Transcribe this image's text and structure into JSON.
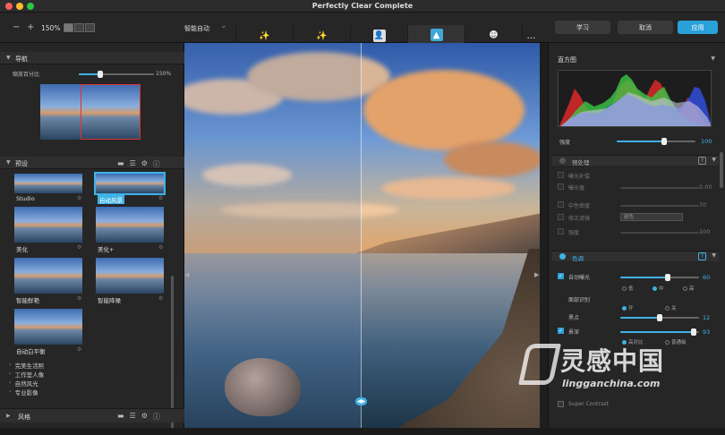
{
  "window": {
    "title": "Perfectly Clear Complete",
    "traffic_lights": {
      "close": "#fe5f57",
      "minimize": "#febc2e",
      "zoom": "#28c840"
    }
  },
  "toolbar": {
    "minus": "−",
    "plus": "+",
    "zoom_level": "150%",
    "auto_label": "智能自动",
    "presets": [
      {
        "label": "iAuto '21",
        "icon": "magic-wand"
      },
      {
        "label": "iAuto Asia",
        "icon": "magic-wand"
      },
      {
        "label": "Studio",
        "icon": "portrait"
      },
      {
        "label": "自动风景",
        "icon": "landscape",
        "active": true
      },
      {
        "label": "美化",
        "icon": "face"
      },
      {
        "label": "I",
        "icon": "more"
      }
    ]
  },
  "actions": {
    "learn": "学习",
    "cancel": "取消",
    "apply": "应用"
  },
  "navigator": {
    "title": "导航",
    "zoom_label": "缩放百分比",
    "zoom_value": "150%",
    "zoom_fraction": 0.28
  },
  "presets_panel": {
    "title": "预设",
    "items": [
      {
        "label": "Studio",
        "selected": false
      },
      {
        "label": "自动风景",
        "selected": true
      },
      {
        "label": "美化",
        "selected": false
      },
      {
        "label": "美化+",
        "selected": false
      },
      {
        "label": "智能鲜艳",
        "selected": false
      },
      {
        "label": "智能降噪",
        "selected": false
      },
      {
        "label": "自动白平衡",
        "selected": false
      }
    ],
    "categories": [
      "完美生活照",
      "工作室人像",
      "自然风光",
      "专业影像"
    ]
  },
  "looks_panel": {
    "title": "风格"
  },
  "histogram": {
    "title": "直方图"
  },
  "strength": {
    "label": "强度",
    "value": "100",
    "fraction": 0.6
  },
  "preprocess": {
    "title": "预处理",
    "rows": [
      {
        "label": "曝光补偿",
        "value": ""
      },
      {
        "label": "曝光值",
        "value": "0.00"
      },
      {
        "label": "中性密度",
        "value": "70"
      },
      {
        "label": "修正滤镜",
        "value": "颜色"
      },
      {
        "label": "强度",
        "value": "100"
      }
    ]
  },
  "tone": {
    "title": "色调",
    "auto_exposure": {
      "label": "自动曝光",
      "value": "60",
      "fraction": 0.6
    },
    "exposure_levels": [
      "低",
      "中",
      "高"
    ],
    "exposure_selected": 1,
    "shadow_label": "面部识别",
    "shadow_options": [
      "开",
      "关"
    ],
    "shadow_selected": 0,
    "black_point": {
      "label": "黑点",
      "value": "12",
      "fraction": 0.5
    },
    "depth": {
      "label": "景深",
      "value": "93",
      "fraction": 0.93
    },
    "contrast_options": [
      "高对比",
      "普通级"
    ],
    "contrast_selected": 0,
    "other_label": "Super Contrast"
  },
  "watermark": {
    "cn": "灵感中国",
    "en": "lingganchina.com"
  }
}
